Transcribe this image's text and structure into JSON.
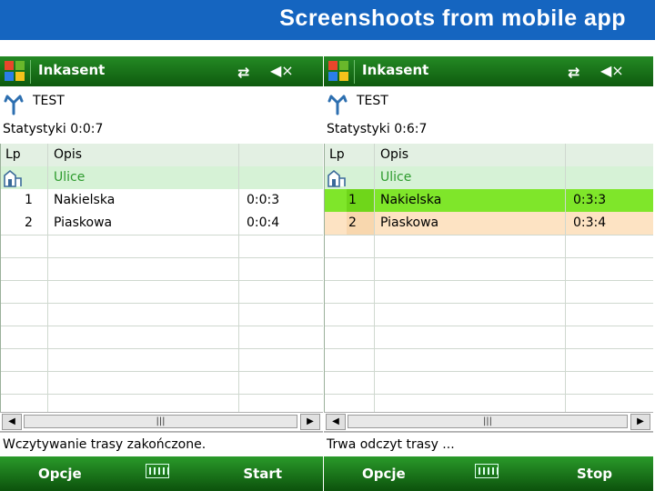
{
  "slide": {
    "title": "Screenshoots from mobile app"
  },
  "screens": [
    {
      "app_title": "Inkasent",
      "name": "TEST",
      "stats": "Statystyki 0:0:7",
      "columns": [
        "Lp",
        "Opis"
      ],
      "group_label": "Ulice",
      "rows": [
        {
          "lp": "1",
          "opis": "Nakielska",
          "time": "0:0:3",
          "state": "normal"
        },
        {
          "lp": "2",
          "opis": "Piaskowa",
          "time": "0:0:4",
          "state": "normal"
        }
      ],
      "status": "Wczytywanie trasy zakończone.",
      "softkeys": {
        "left": "Opcje",
        "right": "Start"
      }
    },
    {
      "app_title": "Inkasent",
      "name": "TEST",
      "stats": "Statystyki 0:6:7",
      "columns": [
        "Lp",
        "Opis"
      ],
      "group_label": "Ulice",
      "rows": [
        {
          "lp": "1",
          "opis": "Nakielska",
          "time": "0:3:3",
          "state": "done"
        },
        {
          "lp": "2",
          "opis": "Piaskowa",
          "time": "0:3:4",
          "state": "active"
        }
      ],
      "status": "Trwa odczyt trasy ...",
      "softkeys": {
        "left": "Opcje",
        "right": "Stop"
      }
    }
  ],
  "colors": {
    "done_row": "#7fe62a",
    "done_lp": "#6fd61a",
    "active_row": "#fde3c3",
    "active_lp": "#f8d7ae",
    "group_row": "#d6f2d6"
  },
  "icons": [
    "windows-start-icon",
    "connectivity-icon",
    "volume-muted-icon",
    "route-app-icon",
    "building-icon",
    "scroll-left-icon",
    "scroll-right-icon",
    "keyboard-icon"
  ]
}
